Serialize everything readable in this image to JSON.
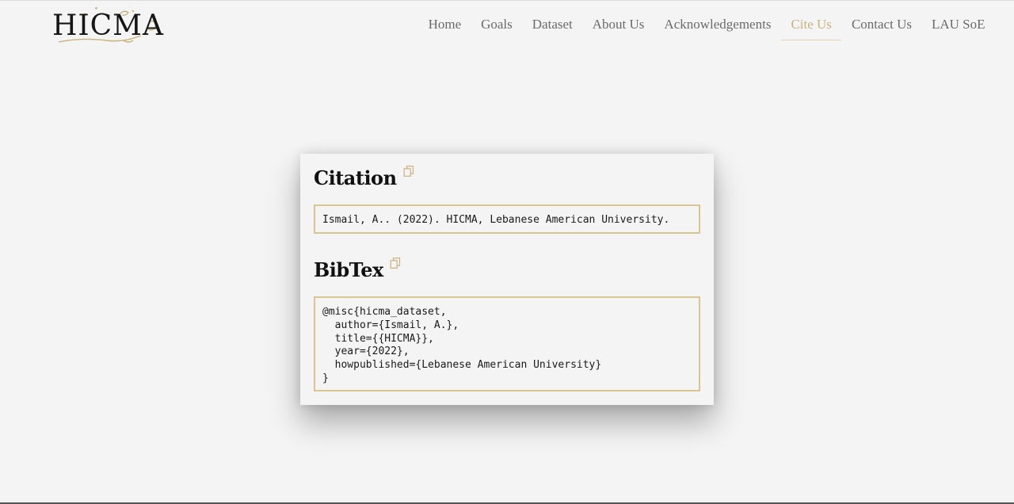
{
  "header": {
    "logo_text": "HICMA",
    "nav": [
      {
        "label": "Home"
      },
      {
        "label": "Goals"
      },
      {
        "label": "Dataset"
      },
      {
        "label": "About Us"
      },
      {
        "label": "Acknowledgements"
      },
      {
        "label": "Cite Us"
      },
      {
        "label": "Contact Us"
      },
      {
        "label": "LAU SoE"
      }
    ],
    "active_nav": "Cite Us"
  },
  "citation": {
    "title": "Citation",
    "text": "Ismail, A.. (2022). HICMA, Lebanese American University."
  },
  "bibtex": {
    "title": "BibTex",
    "lines": [
      "@misc{hicma_dataset,",
      "  author={Ismail, A.},",
      "  title={{HICMA}},",
      "  year={2022},",
      "  howpublished={Lebanese American University}",
      "}"
    ]
  },
  "icons": {
    "copy": "copy-icon"
  },
  "colors": {
    "accent": "#c9b27c",
    "box_border": "#d8c592",
    "background": "#f4f4f4",
    "nav_text": "#6b6b6b"
  }
}
